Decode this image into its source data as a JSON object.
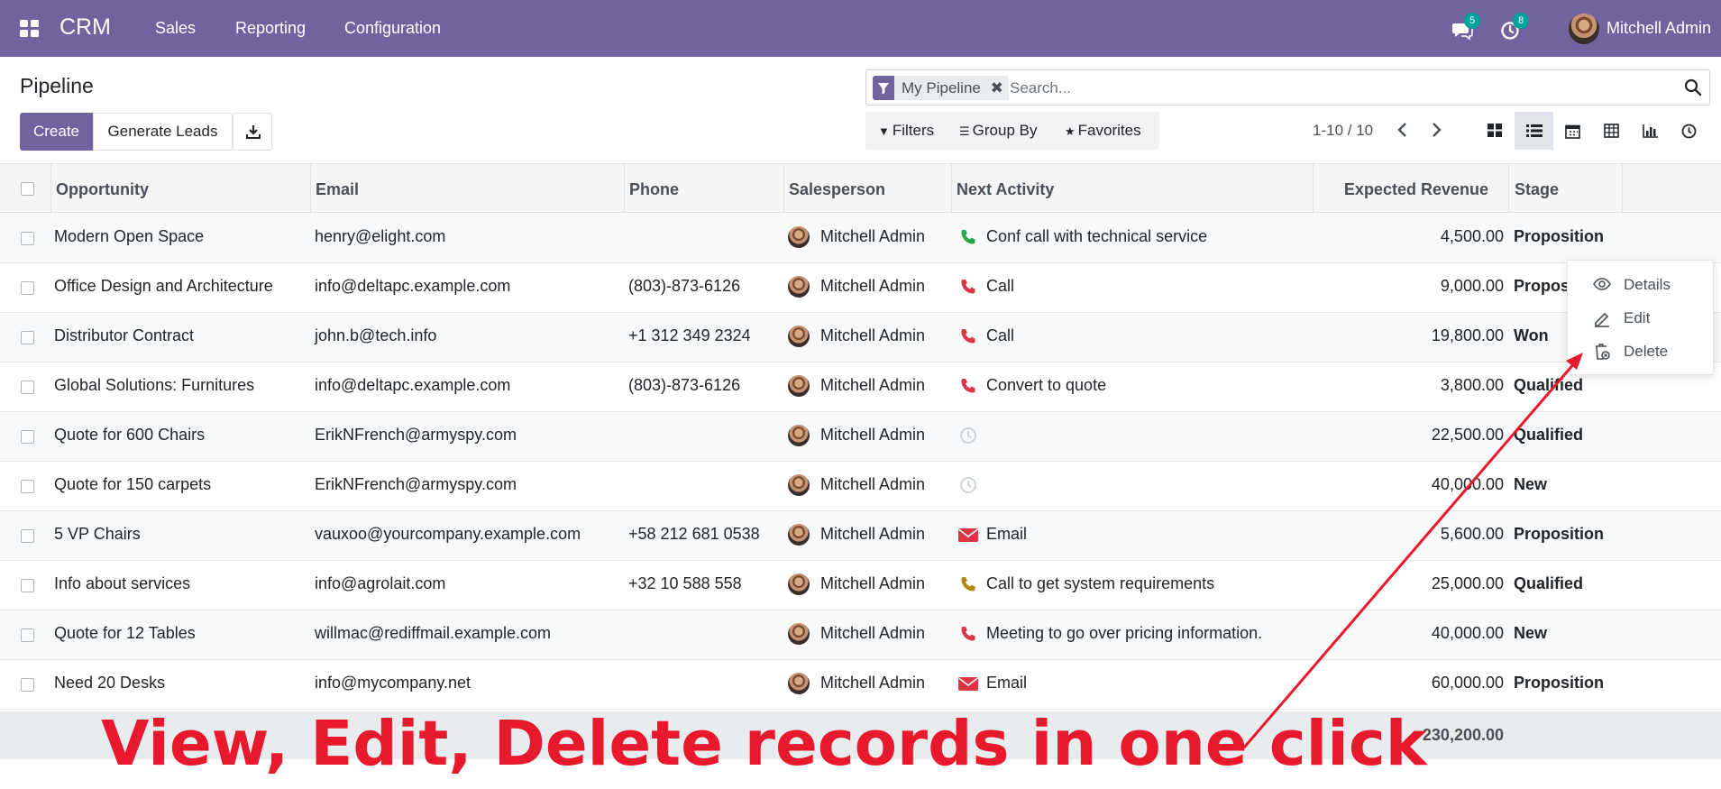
{
  "navbar": {
    "brand": "CRM",
    "menu": [
      "Sales",
      "Reporting",
      "Configuration"
    ],
    "messages_count": "5",
    "activities_count": "8",
    "user_name": "Mitchell Admin"
  },
  "control_panel": {
    "title": "Pipeline",
    "create_label": "Create",
    "generate_leads_label": "Generate Leads",
    "search": {
      "facet": "My Pipeline",
      "placeholder": "Search..."
    },
    "filters_label": "Filters",
    "group_by_label": "Group By",
    "favorites_label": "Favorites",
    "pager": "1-10 / 10",
    "views": [
      "kanban-view",
      "list-view",
      "calendar-view",
      "pivot-view",
      "graph-view",
      "activity-view"
    ],
    "active_view": "list-view"
  },
  "table": {
    "columns": [
      "Opportunity",
      "Email",
      "Phone",
      "Salesperson",
      "Next Activity",
      "Expected Revenue",
      "Stage"
    ],
    "rows": [
      {
        "opportunity": "Modern Open Space",
        "email": "henry@elight.com",
        "phone": "",
        "salesperson": "Mitchell Admin",
        "activity_icon": "phone-icon",
        "activity_color": "#28a745",
        "activity": "Conf call with technical service",
        "revenue": "4,500.00",
        "stage": "Proposition"
      },
      {
        "opportunity": "Office Design and Architecture",
        "email": "info@deltapc.example.com",
        "phone": "(803)-873-6126",
        "salesperson": "Mitchell Admin",
        "activity_icon": "phone-icon",
        "activity_color": "#dc3545",
        "activity": "Call",
        "revenue": "9,000.00",
        "stage": "Propos"
      },
      {
        "opportunity": "Distributor Contract",
        "email": "john.b@tech.info",
        "phone": "+1 312 349 2324",
        "salesperson": "Mitchell Admin",
        "activity_icon": "phone-icon",
        "activity_color": "#dc3545",
        "activity": "Call",
        "revenue": "19,800.00",
        "stage": "Won"
      },
      {
        "opportunity": "Global Solutions: Furnitures",
        "email": "info@deltapc.example.com",
        "phone": "(803)-873-6126",
        "salesperson": "Mitchell Admin",
        "activity_icon": "phone-icon",
        "activity_color": "#dc3545",
        "activity": "Convert to quote",
        "revenue": "3,800.00",
        "stage": "Qualified"
      },
      {
        "opportunity": "Quote for 600 Chairs",
        "email": "ErikNFrench@armyspy.com",
        "phone": "",
        "salesperson": "Mitchell Admin",
        "activity_icon": "clock-icon",
        "activity_color": "#ced4da",
        "activity": "",
        "revenue": "22,500.00",
        "stage": "Qualified"
      },
      {
        "opportunity": "Quote for 150 carpets",
        "email": "ErikNFrench@armyspy.com",
        "phone": "",
        "salesperson": "Mitchell Admin",
        "activity_icon": "clock-icon",
        "activity_color": "#ced4da",
        "activity": "",
        "revenue": "40,000.00",
        "stage": "New"
      },
      {
        "opportunity": "5 VP Chairs",
        "email": "vauxoo@yourcompany.example.com",
        "phone": "+58 212 681 0538",
        "salesperson": "Mitchell Admin",
        "activity_icon": "envelope-icon",
        "activity_color": "#dc3545",
        "activity": "Email",
        "revenue": "5,600.00",
        "stage": "Proposition"
      },
      {
        "opportunity": "Info about services",
        "email": "info@agrolait.com",
        "phone": "+32 10 588 558",
        "salesperson": "Mitchell Admin",
        "activity_icon": "phone-icon",
        "activity_color": "#b8860b",
        "activity": "Call to get system requirements",
        "revenue": "25,000.00",
        "stage": "Qualified"
      },
      {
        "opportunity": "Quote for 12 Tables",
        "email": "willmac@rediffmail.example.com",
        "phone": "",
        "salesperson": "Mitchell Admin",
        "activity_icon": "phone-icon",
        "activity_color": "#dc3545",
        "activity": "Meeting to go over pricing information.",
        "revenue": "40,000.00",
        "stage": "New"
      },
      {
        "opportunity": "Need 20 Desks",
        "email": "info@mycompany.net",
        "phone": "",
        "salesperson": "Mitchell Admin",
        "activity_icon": "envelope-icon",
        "activity_color": "#dc3545",
        "activity": "Email",
        "revenue": "60,000.00",
        "stage": "Proposition"
      }
    ],
    "total_revenue": "230,200.00"
  },
  "context_menu": {
    "items": [
      "Details",
      "Edit",
      "Delete"
    ]
  },
  "annotation": {
    "text": "View, Edit, Delete records in one click",
    "color": "#e8192c"
  },
  "colors": {
    "brand": "#71639e",
    "badge": "#00a09d"
  }
}
